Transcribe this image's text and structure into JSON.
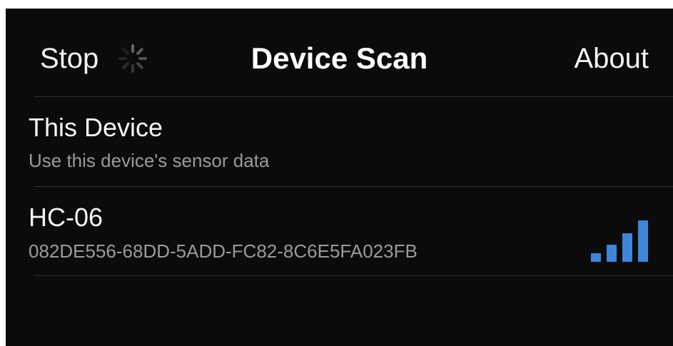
{
  "nav": {
    "left_label": "Stop",
    "title": "Device Scan",
    "right_label": "About",
    "activity_icon": "spinner-icon"
  },
  "devices": [
    {
      "name": "This Device",
      "subtitle": "Use this device's sensor data"
    },
    {
      "name": "HC-06",
      "subtitle": "082DE556-68DD-5ADD-FC82-8C6E5FA023FB",
      "signal_icon": "signal-strength-icon",
      "signal_bars_filled": 4,
      "signal_bars_total": 4
    }
  ],
  "colors": {
    "background": "#0b0b0b",
    "text": "#f4f4f4",
    "subtext": "#9a9a9a",
    "separator": "#2e2e2e",
    "signal": "#3d86d8"
  }
}
